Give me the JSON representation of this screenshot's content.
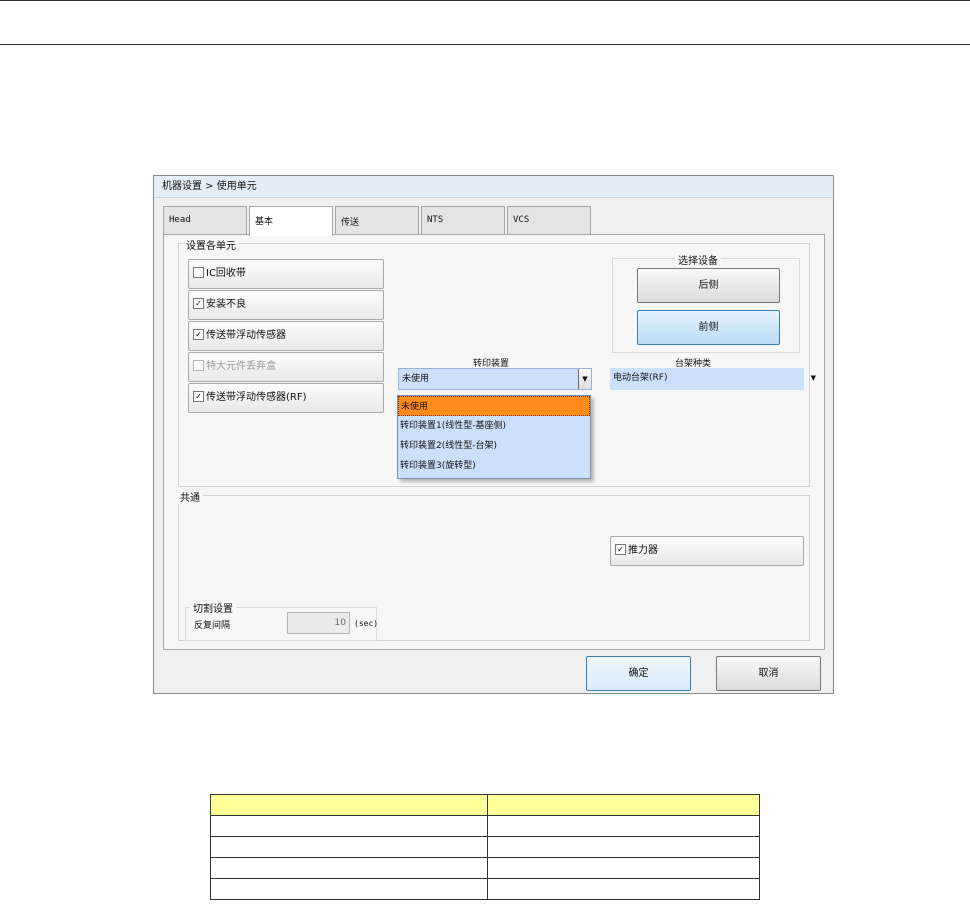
{
  "window": {
    "title": "机器设置 > 使用单元",
    "tabs": [
      {
        "label": "Head"
      },
      {
        "label": "基本"
      },
      {
        "label": "传送"
      },
      {
        "label": "NTS"
      },
      {
        "label": "VCS"
      }
    ],
    "active_tab": "基本",
    "units": {
      "group_label": "设置各单元",
      "items": [
        {
          "label": "IC回收带",
          "checked": false,
          "enabled": true
        },
        {
          "label": "安装不良",
          "checked": true,
          "enabled": true
        },
        {
          "label": "传送带浮动传感器",
          "checked": true,
          "enabled": true
        },
        {
          "label": "特大元件丢弃盒",
          "checked": false,
          "enabled": false
        },
        {
          "label": "传送带浮动传感器(RF)",
          "checked": true,
          "enabled": true
        }
      ]
    },
    "select_device": {
      "label": "选择设备",
      "rear": "后侧",
      "front": "前侧",
      "selected": "前侧"
    },
    "transfer_device": {
      "label": "转印装置",
      "value": "未使用",
      "options": [
        "未使用",
        "转印装置1(线性型-基座侧)",
        "转印装置2(线性型-台架)",
        "转印装置3(旋转型)"
      ]
    },
    "table_type": {
      "label": "台架种类",
      "value": "电动台架(RF)"
    },
    "common": {
      "group_label": "共通",
      "assist": {
        "label": "推力器",
        "checked": true
      }
    },
    "switch": {
      "group_label": "切割设置",
      "interval_label": "反复间隔",
      "interval_value": "10",
      "unit": "(sec)"
    },
    "buttons": {
      "ok": "确定",
      "cancel": "取消"
    }
  },
  "colors": {
    "selected_option": "#ff8c1a",
    "table_header": "#ffff99",
    "select_field": "#cde0fb"
  }
}
